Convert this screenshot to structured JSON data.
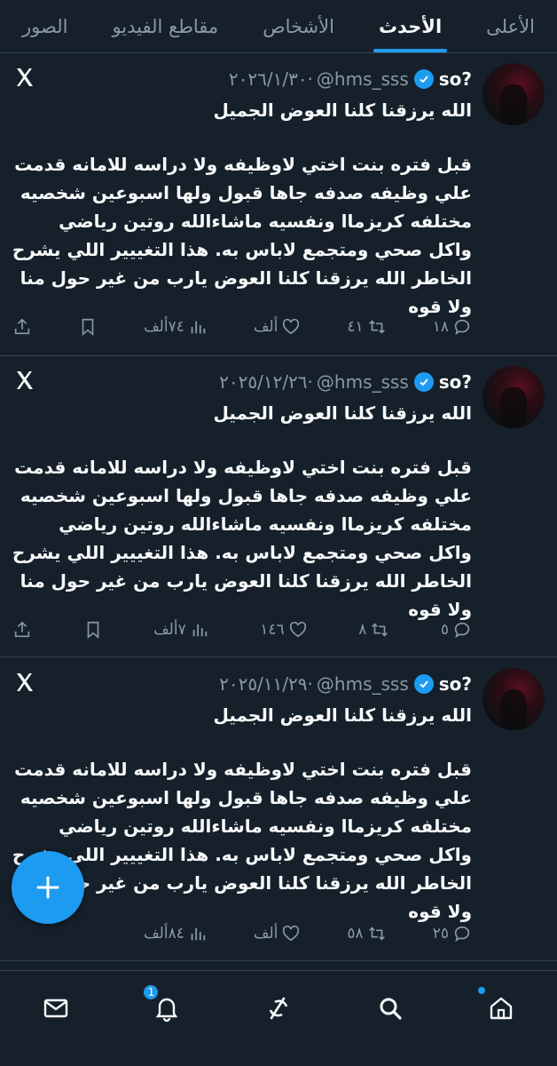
{
  "tabs": [
    {
      "label": "الأعلى",
      "active": false
    },
    {
      "label": "الأحدث",
      "active": true
    },
    {
      "label": "الأشخاص",
      "active": false
    },
    {
      "label": "مقاطع الفيديو",
      "active": false
    },
    {
      "label": "الصور",
      "active": false
    }
  ],
  "tweets": [
    {
      "name": "so?",
      "handle": "@hms_sss",
      "date": "٢٠٢٦/١/٣٠·",
      "title": "الله يرزقنا كلنا العوض الجميل",
      "body": "قبل فتره بنت اختي لاوظيفه ولا دراسه للامانه قدمت علي وظيفه صدفه جاها قبول ولها اسبوعين شخصيه مختلفه كريزماا ونفسيه ماشاءالله روتين رياضي واكل صحي ومتجمع لاباس به. هذا التغييير اللي يشرح الخاطر الله يرزقنا كلنا العوض يارب من غير حول منا ولا قوه",
      "replies": "١٨",
      "reposts": "٤١",
      "likes": "ألف",
      "views": "٧٤ألف"
    },
    {
      "name": "so?",
      "handle": "@hms_sss",
      "date": "٢٠٢٥/١٢/٢٦·",
      "title": "الله يرزقنا كلنا العوض الجميل",
      "body": "قبل فتره بنت اختي لاوظيفه ولا دراسه للامانه قدمت علي وظيفه صدفه جاها قبول ولها اسبوعين شخصيه مختلفه كريزماا ونفسيه ماشاءالله روتين رياضي واكل صحي ومتجمع لاباس به. هذا التغييير اللي يشرح الخاطر الله يرزقنا كلنا العوض يارب من غير حول منا ولا قوه",
      "replies": "٥",
      "reposts": "٨",
      "likes": "١٤٦",
      "views": "٧ألف"
    },
    {
      "name": "so?",
      "handle": "@hms_sss",
      "date": "٢٠٢٥/١١/٢٩·",
      "title": "الله يرزقنا كلنا العوض الجميل",
      "body": "قبل فتره بنت اختي لاوظيفه ولا دراسه للامانه قدمت علي وظيفه صدفه جاها قبول ولها اسبوعين شخصيه مختلفه كريزماا ونفسيه ماشاءالله روتين رياضي واكل صحي ومتجمع لاباس به. هذا التغييير اللي يشرح الخاطر الله يرزقنا كلنا العوض يارب من غير حول منا ولا قوه",
      "replies": "٢٥",
      "reposts": "٥٨",
      "likes": "ألف",
      "views": "٨٤ألف"
    }
  ],
  "bottom_nav": {
    "notifications_badge": "1"
  },
  "icons": {
    "reply": "reply-icon",
    "repost": "repost-icon",
    "like": "heart-icon",
    "views": "views-icon",
    "bookmark": "bookmark-icon",
    "share": "share-icon",
    "compose": "plus-icon"
  },
  "colors": {
    "background": "#15202b",
    "accent": "#1d9bf0",
    "muted": "#8b98a5",
    "divider": "#38444d"
  }
}
